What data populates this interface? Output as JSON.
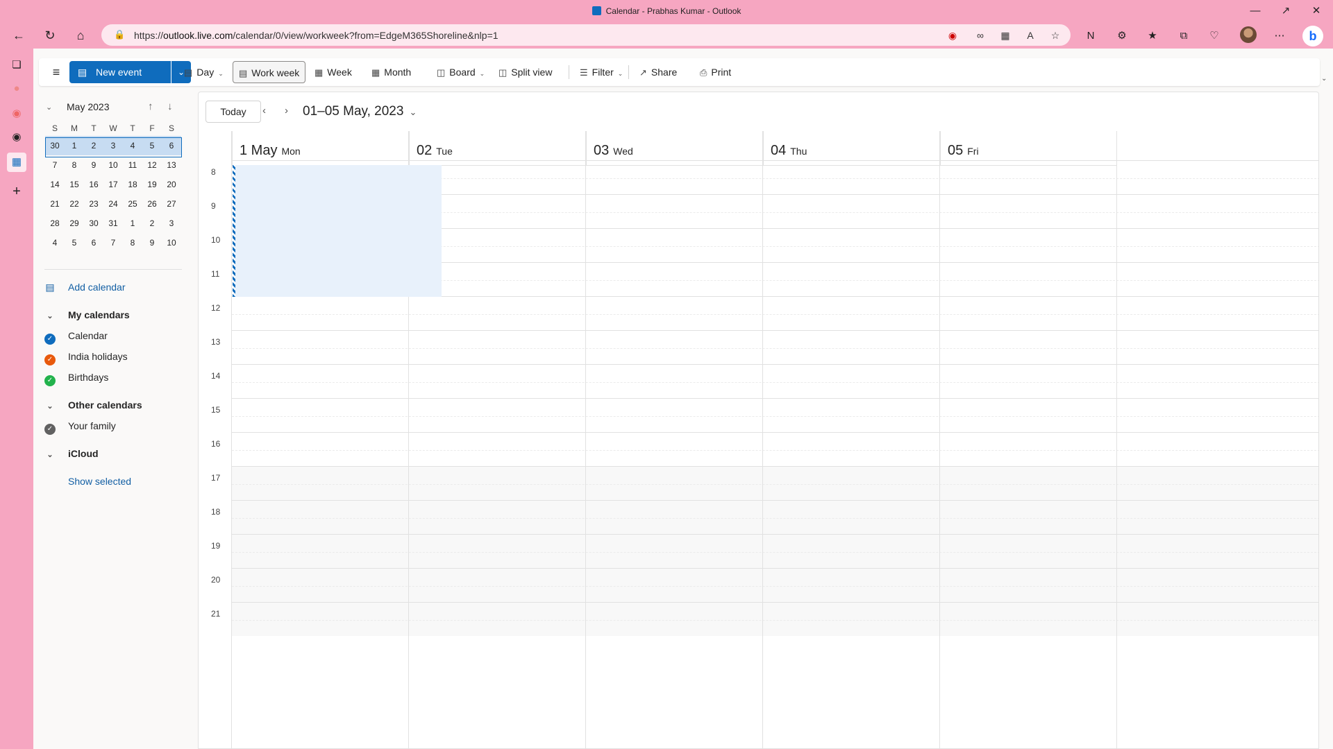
{
  "browser": {
    "window_title": "Calendar - Prabhas Kumar - Outlook",
    "url_scheme": "https://",
    "url_host": "outlook.live.com",
    "url_path": "/calendar/0/view/workweek?from=EdgeM365Shoreline&nlp=1"
  },
  "ribbon": {
    "new_event": "New event",
    "day": "Day",
    "work_week": "Work week",
    "week": "Week",
    "month": "Month",
    "board": "Board",
    "split_view": "Split view",
    "filter": "Filter",
    "share": "Share",
    "print": "Print",
    "selected_view": "Work week"
  },
  "mini_calendar": {
    "title": "May 2023",
    "weekdays": [
      "S",
      "M",
      "T",
      "W",
      "T",
      "F",
      "S"
    ],
    "weeks": [
      [
        "30",
        "1",
        "2",
        "3",
        "4",
        "5",
        "6"
      ],
      [
        "7",
        "8",
        "9",
        "10",
        "11",
        "12",
        "13"
      ],
      [
        "14",
        "15",
        "16",
        "17",
        "18",
        "19",
        "20"
      ],
      [
        "21",
        "22",
        "23",
        "24",
        "25",
        "26",
        "27"
      ],
      [
        "28",
        "29",
        "30",
        "31",
        "1",
        "2",
        "3"
      ],
      [
        "4",
        "5",
        "6",
        "7",
        "8",
        "9",
        "10"
      ]
    ],
    "selected_week_index": 0
  },
  "sidebar": {
    "add_calendar": "Add calendar",
    "my_calendars_header": "My calendars",
    "my_calendars": [
      {
        "label": "Calendar",
        "color": "#0f6cbd"
      },
      {
        "label": "India holidays",
        "color": "#e8590c"
      },
      {
        "label": "Birthdays",
        "color": "#22b24c"
      }
    ],
    "other_calendars_header": "Other calendars",
    "other_calendars": [
      {
        "label": "Your family",
        "color": "#616161"
      }
    ],
    "icloud_header": "iCloud",
    "show_selected": "Show selected"
  },
  "calendar": {
    "today_button": "Today",
    "date_range": "01–05 May, 2023",
    "days": [
      {
        "num": "1 May",
        "name": "Mon"
      },
      {
        "num": "02",
        "name": "Tue"
      },
      {
        "num": "03",
        "name": "Wed"
      },
      {
        "num": "04",
        "name": "Thu"
      },
      {
        "num": "05",
        "name": "Fri"
      }
    ],
    "hours": [
      "8",
      "9",
      "10",
      "11",
      "12",
      "13",
      "14",
      "15",
      "16",
      "17",
      "18",
      "19",
      "20",
      "21"
    ],
    "working_hours_end": "17"
  }
}
